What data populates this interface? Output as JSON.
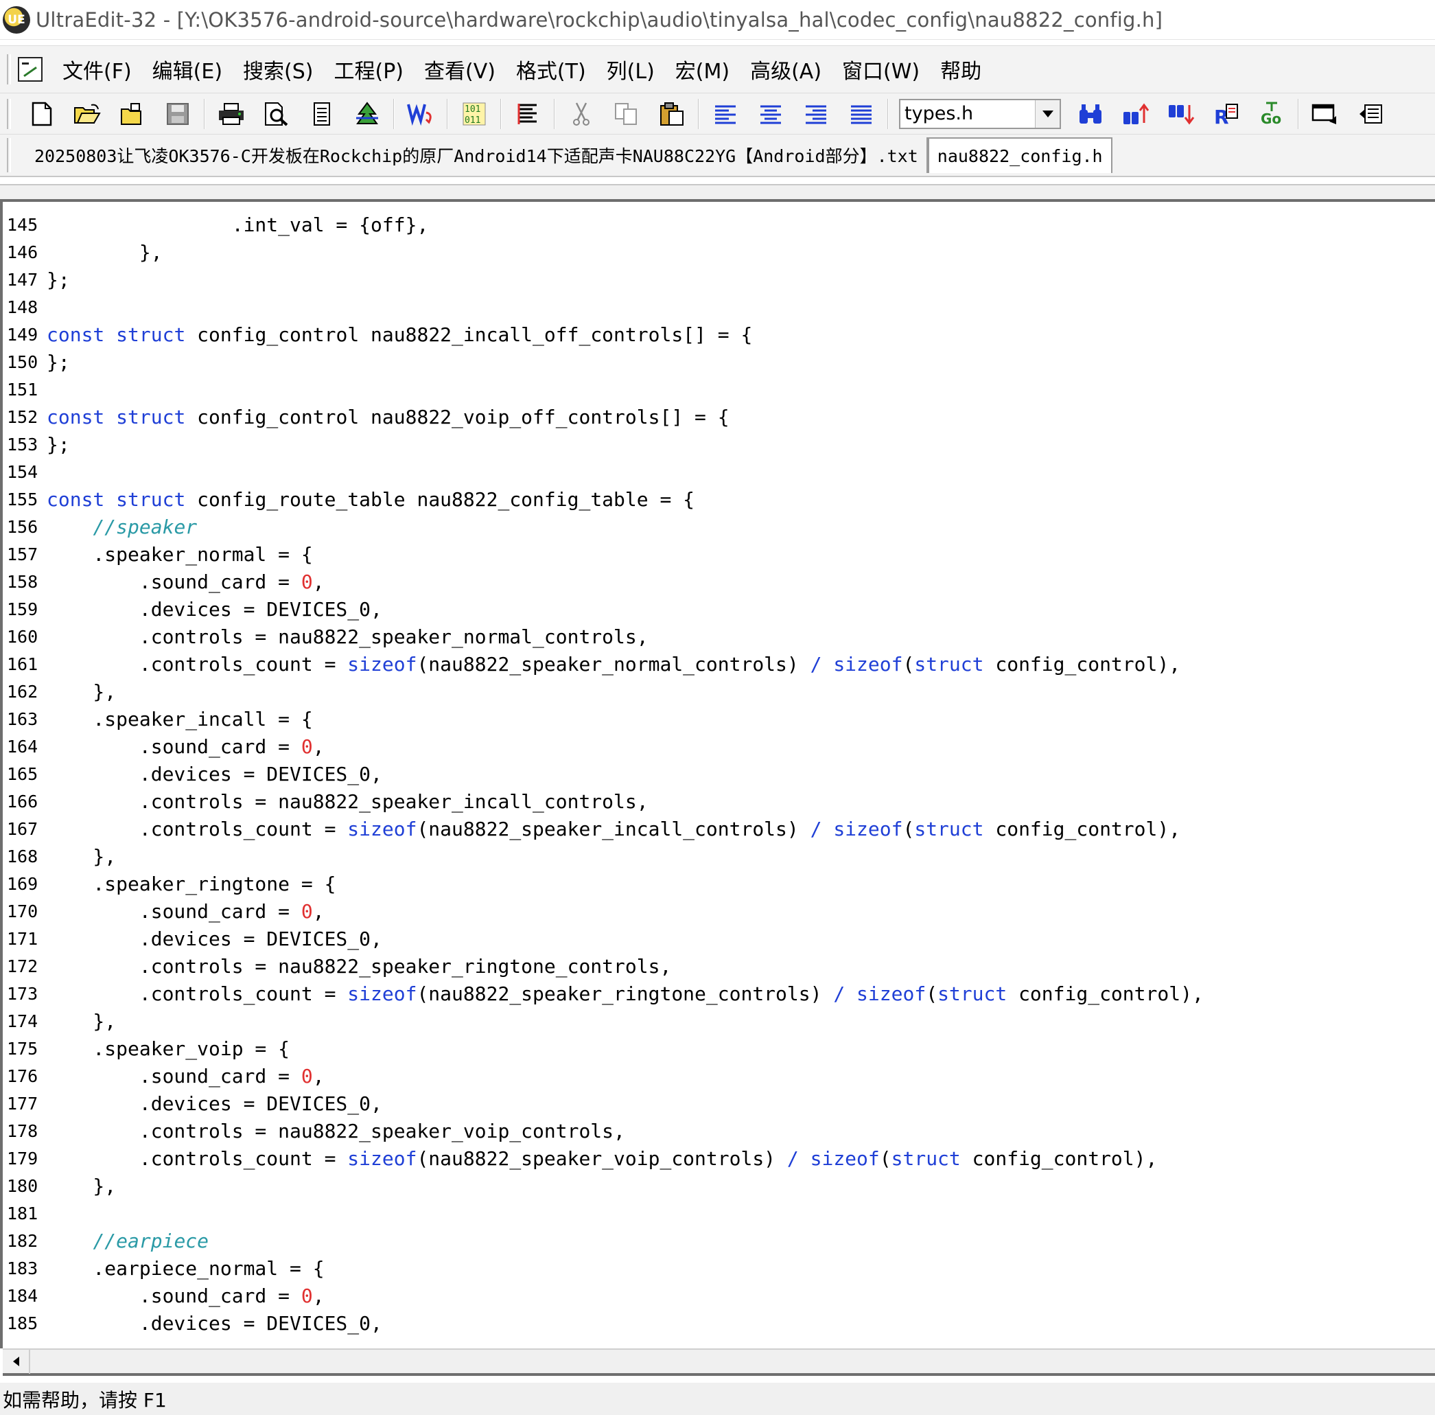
{
  "window": {
    "title": "UltraEdit-32 - [Y:\\OK3576-android-source\\hardware\\rockchip\\audio\\tinyalsa_hal\\codec_config\\nau8822_config.h]",
    "logo_text": "UE"
  },
  "menu": {
    "items": [
      "文件(F)",
      "编辑(E)",
      "搜索(S)",
      "工程(P)",
      "查看(V)",
      "格式(T)",
      "列(L)",
      "宏(M)",
      "高级(A)",
      "窗口(W)",
      "帮助"
    ]
  },
  "toolbar": {
    "combo_value": "types.h"
  },
  "tabs": [
    {
      "label": "20250803让飞凌OK3576-C开发板在Rockchip的原厂Android14下适配声卡NAU88C22YG【Android部分】.txt",
      "active": false
    },
    {
      "label": "nau8822_config.h",
      "active": true
    }
  ],
  "code": {
    "lines": [
      {
        "n": "145",
        "t": "                .int_val = {off},"
      },
      {
        "n": "146",
        "t": "        },"
      },
      {
        "n": "147",
        "t": "};"
      },
      {
        "n": "148",
        "t": ""
      },
      {
        "n": "149",
        "t": "const struct config_control nau8822_incall_off_controls[] = {"
      },
      {
        "n": "150",
        "t": "};"
      },
      {
        "n": "151",
        "t": ""
      },
      {
        "n": "152",
        "t": "const struct config_control nau8822_voip_off_controls[] = {"
      },
      {
        "n": "153",
        "t": "};"
      },
      {
        "n": "154",
        "t": ""
      },
      {
        "n": "155",
        "t": "const struct config_route_table nau8822_config_table = {"
      },
      {
        "n": "156",
        "t": "    //speaker"
      },
      {
        "n": "157",
        "t": "    .speaker_normal = {"
      },
      {
        "n": "158",
        "t": "        .sound_card = 0,"
      },
      {
        "n": "159",
        "t": "        .devices = DEVICES_0,"
      },
      {
        "n": "160",
        "t": "        .controls = nau8822_speaker_normal_controls,"
      },
      {
        "n": "161",
        "t": "        .controls_count = sizeof(nau8822_speaker_normal_controls) / sizeof(struct config_control),"
      },
      {
        "n": "162",
        "t": "    },"
      },
      {
        "n": "163",
        "t": "    .speaker_incall = {"
      },
      {
        "n": "164",
        "t": "        .sound_card = 0,"
      },
      {
        "n": "165",
        "t": "        .devices = DEVICES_0,"
      },
      {
        "n": "166",
        "t": "        .controls = nau8822_speaker_incall_controls,"
      },
      {
        "n": "167",
        "t": "        .controls_count = sizeof(nau8822_speaker_incall_controls) / sizeof(struct config_control),"
      },
      {
        "n": "168",
        "t": "    },"
      },
      {
        "n": "169",
        "t": "    .speaker_ringtone = {"
      },
      {
        "n": "170",
        "t": "        .sound_card = 0,"
      },
      {
        "n": "171",
        "t": "        .devices = DEVICES_0,"
      },
      {
        "n": "172",
        "t": "        .controls = nau8822_speaker_ringtone_controls,"
      },
      {
        "n": "173",
        "t": "        .controls_count = sizeof(nau8822_speaker_ringtone_controls) / sizeof(struct config_control),"
      },
      {
        "n": "174",
        "t": "    },"
      },
      {
        "n": "175",
        "t": "    .speaker_voip = {"
      },
      {
        "n": "176",
        "t": "        .sound_card = 0,"
      },
      {
        "n": "177",
        "t": "        .devices = DEVICES_0,"
      },
      {
        "n": "178",
        "t": "        .controls = nau8822_speaker_voip_controls,"
      },
      {
        "n": "179",
        "t": "        .controls_count = sizeof(nau8822_speaker_voip_controls) / sizeof(struct config_control),"
      },
      {
        "n": "180",
        "t": "    },"
      },
      {
        "n": "181",
        "t": ""
      },
      {
        "n": "182",
        "t": "    //earpiece"
      },
      {
        "n": "183",
        "t": "    .earpiece_normal = {"
      },
      {
        "n": "184",
        "t": "        .sound_card = 0,"
      },
      {
        "n": "185",
        "t": "        .devices = DEVICES_0,"
      }
    ]
  },
  "status": {
    "text": "如需帮助，请按 F1"
  },
  "colors": {
    "keyword": "#1f3fd6",
    "comment": "#2a9aa6",
    "number": "#e03030"
  }
}
